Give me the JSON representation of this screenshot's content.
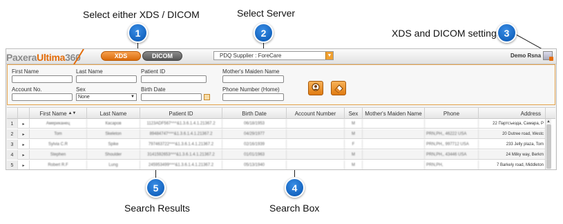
{
  "callouts": {
    "c1": {
      "number": "1",
      "label": "Select either XDS / DICOM"
    },
    "c2": {
      "number": "2",
      "label": "Select Server"
    },
    "c3": {
      "number": "3",
      "label": "XDS and DICOM settings"
    },
    "c4": {
      "number": "4",
      "label": "Search Box"
    },
    "c5": {
      "number": "5",
      "label": "Search Results"
    }
  },
  "header": {
    "logo_part1": "Paxera",
    "logo_part2": "Ultima",
    "logo_part3": "360",
    "xds_label": "XDS",
    "dicom_label": "DICOM",
    "server_value": "PDQ Supplier : ForeCare",
    "user_name": "Demo Rsna"
  },
  "search": {
    "first_name_label": "First Name",
    "last_name_label": "Last Name",
    "patient_id_label": "Patient ID",
    "mothers_maiden_label": "Mother's Maiden Name",
    "account_no_label": "Account No.",
    "sex_label": "Sex",
    "sex_value": "None",
    "birth_date_label": "Birth Date",
    "phone_label": "Phone Number (Home)"
  },
  "grid": {
    "columns": [
      "First Name",
      "Last Name",
      "Patient ID",
      "Birth Date",
      "Account Number",
      "Sex",
      "Mother's Maiden Name",
      "Phone",
      "Address"
    ],
    "rows": [
      {
        "num": "1",
        "first": "Американец",
        "last": "Касаров",
        "pid": "1123ADF567^^^&1.3.6.1.4.1.21367.2",
        "dob": "06/18/1953",
        "acct": "",
        "sex": "M",
        "mmn": "",
        "phone": "",
        "address": "22 Партсъезда, Самара, Р"
      },
      {
        "num": "2",
        "first": "Tom",
        "last": "Skeleton",
        "pid": "89484747^^^&1.3.6.1.4.1.21367.2",
        "dob": "04/29/1977",
        "acct": "",
        "sex": "M",
        "mmn": "",
        "phone": "PRN,PH,, 46222 USA",
        "address": "20 Dutree road, Westc"
      },
      {
        "num": "3",
        "first": "Sylvia C.R",
        "last": "Spike",
        "pid": "797463722^^^&1.3.6.1.4.1.21367.2",
        "dob": "02/16/1939",
        "acct": "",
        "sex": "F",
        "mmn": "",
        "phone": "PRN,PH,, 997712 USA",
        "address": "233 Jelly plaza, Tom"
      },
      {
        "num": "4",
        "first": "Stephen",
        "last": "Shoulder",
        "pid": "3141592653^^^&1.3.6.1.4.1.21367.2",
        "dob": "01/01/1963",
        "acct": "",
        "sex": "M",
        "mmn": "",
        "phone": "PRN,PH,, 43446 USA",
        "address": "24 Milky way, Berkm"
      },
      {
        "num": "5",
        "first": "Robert R.F",
        "last": "Lung",
        "pid": "245953499^^^&1.3.6.1.4.1.21367.2",
        "dob": "05/13/1940",
        "acct": "",
        "sex": "M",
        "mmn": "",
        "phone": "PRN,PH,",
        "address": "7 Barkely road, Middleton"
      }
    ]
  }
}
